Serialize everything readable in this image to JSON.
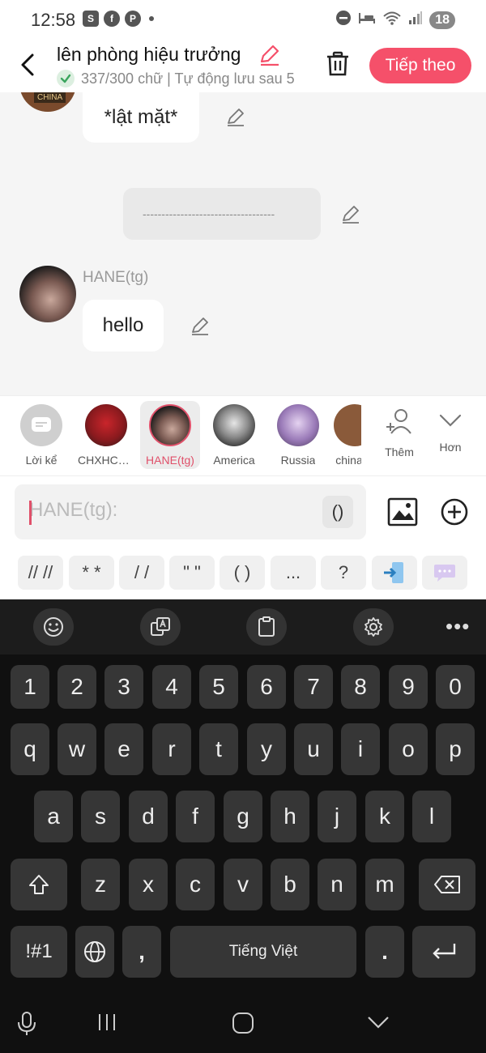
{
  "status_bar": {
    "time": "12:58",
    "battery": "18",
    "left_icons": [
      "shopee-icon",
      "facebook-icon",
      "pinterest-icon",
      "dot-icon"
    ],
    "right_icons": [
      "dnd-icon",
      "bed-icon",
      "wifi-icon",
      "signal-icon"
    ]
  },
  "header": {
    "title": "lên phòng hiệu trưởng",
    "subtitle": "337/300 chữ | Tự động lưu sau 5",
    "next_label": "Tiếp theo",
    "accent": "#f5506a"
  },
  "chat": {
    "messages": [
      {
        "text": "*lật mặt*"
      },
      {
        "text": "-----------------------------------"
      },
      {
        "name": "HANE(tg)",
        "text": "hello"
      }
    ],
    "partial_avatar_label": "CHINA"
  },
  "characters": [
    {
      "label": "Lời kể"
    },
    {
      "label": "CHXHCN..."
    },
    {
      "label": "HANE(tg)",
      "selected": true
    },
    {
      "label": "America"
    },
    {
      "label": "Russia"
    },
    {
      "label": "china"
    },
    {
      "label": "Thêm"
    },
    {
      "label": "Hơn"
    }
  ],
  "input": {
    "placeholder": "HANE(tg):",
    "paren_label": "()"
  },
  "quick_inserts": [
    "// //",
    "* *",
    "/ /",
    "\" \"",
    "( )",
    "...",
    "?"
  ],
  "keyboard": {
    "row_numbers": [
      "1",
      "2",
      "3",
      "4",
      "5",
      "6",
      "7",
      "8",
      "9",
      "0"
    ],
    "row1": [
      "q",
      "w",
      "e",
      "r",
      "t",
      "y",
      "u",
      "i",
      "o",
      "p"
    ],
    "row2": [
      "a",
      "s",
      "d",
      "f",
      "g",
      "h",
      "j",
      "k",
      "l"
    ],
    "row3": [
      "z",
      "x",
      "c",
      "v",
      "b",
      "n",
      "m"
    ],
    "symbols_key": "!#1",
    "comma_key": ",",
    "space_label": "Tiếng Việt",
    "period_key": "."
  }
}
